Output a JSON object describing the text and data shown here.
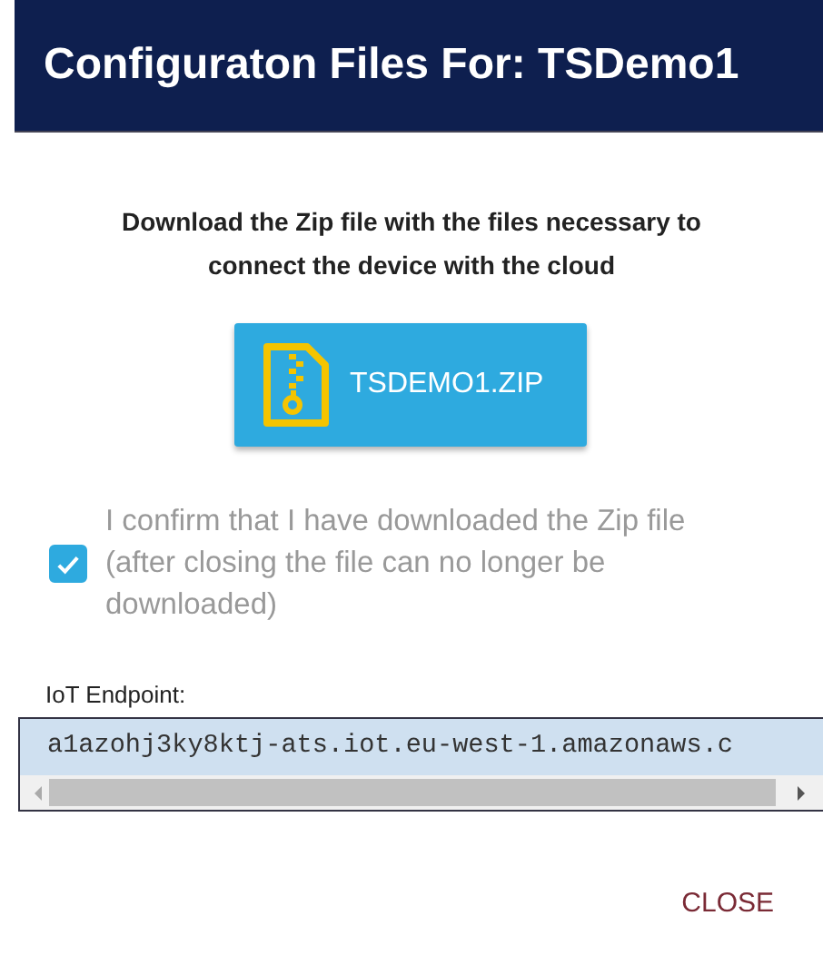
{
  "dialog": {
    "title": "Configuraton Files For: TSDemo1"
  },
  "instructions": "Download the Zip file with the files necessary to connect the device with the cloud",
  "download_button": {
    "label": "TSDEMO1.ZIP"
  },
  "confirm": {
    "label": "I confirm that I have downloaded the Zip file (after closing the file can no longer be downloaded)",
    "checked": true
  },
  "endpoint": {
    "label": "IoT Endpoint:",
    "value": "a1azohj3ky8ktj-ats.iot.eu-west-1.amazonaws.c"
  },
  "buttons": [
    {
      "label": "CLOSE"
    }
  ]
}
